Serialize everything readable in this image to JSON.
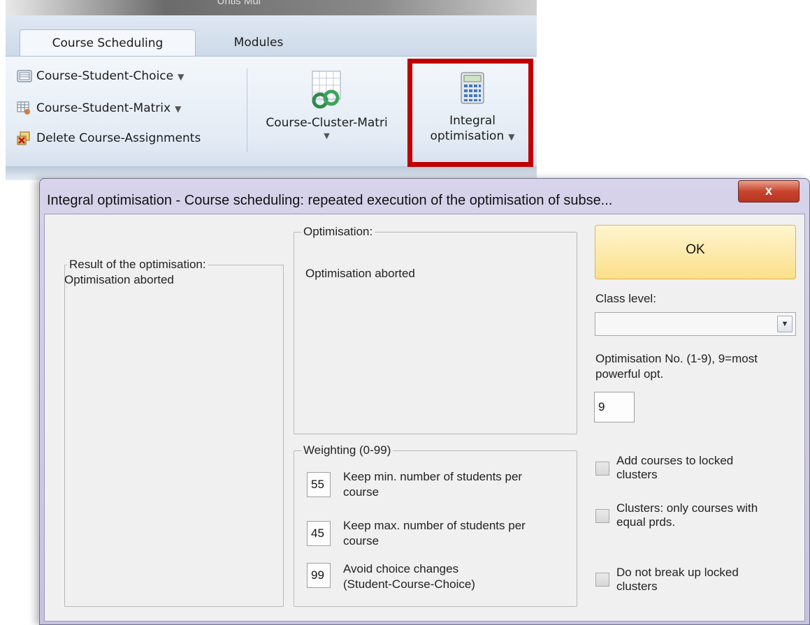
{
  "ribbon": {
    "app_title_fragment": "Untis Mul",
    "tabs": [
      {
        "label": "Course Scheduling",
        "active": true
      },
      {
        "label": "Modules",
        "active": false
      }
    ],
    "small_buttons": [
      {
        "label": "Course-Student-Choice",
        "icon": "grid-list-icon",
        "dropdown": true
      },
      {
        "label": "Course-Student-Matrix",
        "icon": "matrix-icon",
        "dropdown": true
      },
      {
        "label": "Delete Course-Assignments",
        "icon": "delete-assignments-icon",
        "dropdown": false
      }
    ],
    "course_cluster_matrix": {
      "label": "Course-Cluster-Matri",
      "icon": "cluster-matrix-icon"
    },
    "integral_optimisation": {
      "line1": "Integral",
      "line2": "optimisation",
      "icon": "calculator-icon"
    },
    "highlight_color": "#c00000"
  },
  "dialog": {
    "title": "Integral optimisation - Course scheduling: repeated execution of the optimisation of subse...",
    "close_label": "x",
    "result_group": {
      "label": "Result of the optimisation:",
      "value": "Optimisation aborted"
    },
    "optimisation_group": {
      "label": "Optimisation:",
      "value": "Optimisation aborted"
    },
    "weighting": {
      "label": "Weighting (0-99)",
      "items": [
        {
          "value": "55",
          "line1": "Keep min. number of students per",
          "line2": "course"
        },
        {
          "value": "45",
          "line1": "Keep max. number of students per",
          "line2": "course"
        },
        {
          "value": "99",
          "line1": "Avoid choice changes",
          "line2": "(Student-Course-Choice)"
        }
      ]
    },
    "ok_label": "OK",
    "class_level": {
      "label": "Class level:",
      "value": ""
    },
    "optimisation_no": {
      "line1": "Optimisation No. (1-9), 9=most",
      "line2": "powerful opt.",
      "value": "9"
    },
    "checkboxes": [
      {
        "line1": "Add courses to locked",
        "line2": "clusters",
        "checked": false
      },
      {
        "line1": "Clusters: only courses with",
        "line2": "equal prds.",
        "checked": false
      },
      {
        "line1": "Do not break up locked",
        "line2": "clusters",
        "checked": false
      }
    ]
  }
}
